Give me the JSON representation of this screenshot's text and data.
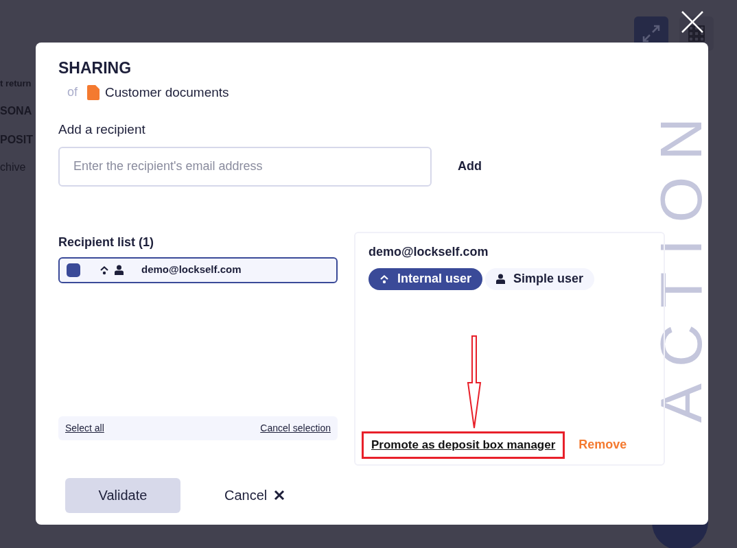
{
  "background": {
    "texts": [
      {
        "kind": "label",
        "text": "t return"
      },
      {
        "kind": "heading",
        "text": "SONA"
      },
      {
        "kind": "heading",
        "text": "POSIT"
      },
      {
        "kind": "item",
        "text": "chive"
      }
    ]
  },
  "dialog": {
    "title": "SHARING",
    "subtitle_prefix": "of",
    "document": "Customer documents",
    "lettering": "ACTION",
    "add_label": "Add a recipient",
    "email_field": {
      "placeholder": "Enter the recipient's email address"
    },
    "add_button": "Add",
    "list_title": "Recipient list (1)",
    "recipients": [
      {
        "email": "demo@lockself.com",
        "checked": true,
        "selected": true
      }
    ],
    "select_all": "Select all",
    "cancel_selection": "Cancel selection",
    "detail": {
      "email": "demo@lockself.com",
      "tags": [
        {
          "kind": "internal",
          "label": "Internal user",
          "selected": true
        },
        {
          "kind": "simple",
          "label": "Simple user",
          "selected": false
        }
      ],
      "promote": "Promote as deposit box manager",
      "remove": "Remove"
    },
    "validate": "Validate",
    "cancel": "Cancel"
  }
}
